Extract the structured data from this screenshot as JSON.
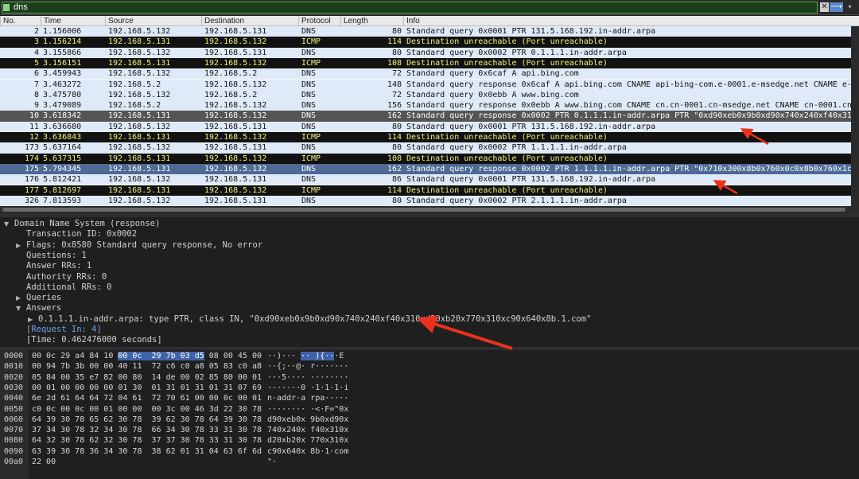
{
  "filter": {
    "value": "dns",
    "clear_icon": "clear-icon",
    "apply_icon": "apply-arrow-icon"
  },
  "columns": [
    "No.",
    "Time",
    "Source",
    "Destination",
    "Protocol",
    "Length",
    "Info"
  ],
  "packets": [
    {
      "no": "2",
      "time": "1.156006",
      "src": "192.168.5.132",
      "dst": "192.168.5.131",
      "proto": "DNS",
      "len": "80",
      "info": "Standard query 0x0001 PTR 131.5.168.192.in-addr.arpa",
      "style": "dns"
    },
    {
      "no": "3",
      "time": "1.156214",
      "src": "192.168.5.131",
      "dst": "192.168.5.132",
      "proto": "ICMP",
      "len": "114",
      "info": "Destination unreachable (Port unreachable)",
      "style": "icmp"
    },
    {
      "no": "4",
      "time": "3.155866",
      "src": "192.168.5.132",
      "dst": "192.168.5.131",
      "proto": "DNS",
      "len": "80",
      "info": "Standard query 0x0002 PTR 0.1.1.1.in-addr.arpa",
      "style": "dns"
    },
    {
      "no": "5",
      "time": "3.156151",
      "src": "192.168.5.131",
      "dst": "192.168.5.132",
      "proto": "ICMP",
      "len": "108",
      "info": "Destination unreachable (Port unreachable)",
      "style": "icmp"
    },
    {
      "no": "6",
      "time": "3.459943",
      "src": "192.168.5.132",
      "dst": "192.168.5.2",
      "proto": "DNS",
      "len": "72",
      "info": "Standard query 0x6caf A api.bing.com",
      "style": "dns"
    },
    {
      "no": "7",
      "time": "3.463272",
      "src": "192.168.5.2",
      "dst": "192.168.5.132",
      "proto": "DNS",
      "len": "148",
      "info": "Standard query response 0x6caf A api.bing.com CNAME api-bing-com.e-0001.e-msedge.net CNAME e-0…",
      "style": "dns"
    },
    {
      "no": "8",
      "time": "3.475780",
      "src": "192.168.5.132",
      "dst": "192.168.5.2",
      "proto": "DNS",
      "len": "72",
      "info": "Standard query 0x0ebb A www.bing.com",
      "style": "dns"
    },
    {
      "no": "9",
      "time": "3.479089",
      "src": "192.168.5.2",
      "dst": "192.168.5.132",
      "proto": "DNS",
      "len": "156",
      "info": "Standard query response 0x0ebb A www.bing.com CNAME cn.cn-0001.cn-msedge.net CNAME cn-0001.cn-…",
      "style": "dns"
    },
    {
      "no": "10",
      "time": "3.618342",
      "src": "192.168.5.131",
      "dst": "192.168.5.132",
      "proto": "DNS",
      "len": "162",
      "info": "Standard query response 0x0002 PTR 0.1.1.1.in-addr.arpa PTR \"0xd90xeb0x9b0xd90x740x240xf40x310…",
      "style": "sel-dark"
    },
    {
      "no": "11",
      "time": "3.636680",
      "src": "192.168.5.132",
      "dst": "192.168.5.131",
      "proto": "DNS",
      "len": "80",
      "info": "Standard query 0x0001 PTR 131.5.168.192.in-addr.arpa",
      "style": "dns"
    },
    {
      "no": "12",
      "time": "3.636843",
      "src": "192.168.5.131",
      "dst": "192.168.5.132",
      "proto": "ICMP",
      "len": "114",
      "info": "Destination unreachable (Port unreachable)",
      "style": "icmp"
    },
    {
      "no": "173",
      "time": "5.637164",
      "src": "192.168.5.132",
      "dst": "192.168.5.131",
      "proto": "DNS",
      "len": "80",
      "info": "Standard query 0x0002 PTR 1.1.1.1.in-addr.arpa",
      "style": "dns"
    },
    {
      "no": "174",
      "time": "5.637315",
      "src": "192.168.5.131",
      "dst": "192.168.5.132",
      "proto": "ICMP",
      "len": "108",
      "info": "Destination unreachable (Port unreachable)",
      "style": "icmp"
    },
    {
      "no": "175",
      "time": "5.794345",
      "src": "192.168.5.131",
      "dst": "192.168.5.132",
      "proto": "DNS",
      "len": "162",
      "info": "Standard query response 0x0002 PTR 1.1.1.1.in-addr.arpa PTR \"0x710x300x8b0x760x0c0x8b0x760x1c0…",
      "style": "sel-blue"
    },
    {
      "no": "176",
      "time": "5.812421",
      "src": "192.168.5.132",
      "dst": "192.168.5.131",
      "proto": "DNS",
      "len": "86",
      "info": "Standard query 0x0001 PTR 131.5.168.192.in-addr.arpa",
      "style": "dns"
    },
    {
      "no": "177",
      "time": "5.812697",
      "src": "192.168.5.131",
      "dst": "192.168.5.132",
      "proto": "ICMP",
      "len": "114",
      "info": "Destination unreachable (Port unreachable)",
      "style": "icmp"
    },
    {
      "no": "326",
      "time": "7.813593",
      "src": "192.168.5.132",
      "dst": "192.168.5.131",
      "proto": "DNS",
      "len": "80",
      "info": "Standard query 0x0002 PTR 2.1.1.1.in-addr.arpa",
      "style": "dns"
    }
  ],
  "details": [
    {
      "text": "Domain Name System (response)",
      "arrow": "▼",
      "level": 0
    },
    {
      "text": "Transaction ID: 0x0002",
      "arrow": "",
      "level": 1
    },
    {
      "text": "Flags: 0x8580 Standard query response, No error",
      "arrow": "▶",
      "level": 1
    },
    {
      "text": "Questions: 1",
      "arrow": "",
      "level": 1
    },
    {
      "text": "Answer RRs: 1",
      "arrow": "",
      "level": 1
    },
    {
      "text": "Authority RRs: 0",
      "arrow": "",
      "level": 1
    },
    {
      "text": "Additional RRs: 0",
      "arrow": "",
      "level": 1
    },
    {
      "text": "Queries",
      "arrow": "▶",
      "level": 1
    },
    {
      "text": "Answers",
      "arrow": "▼",
      "level": 1
    },
    {
      "text": "0.1.1.1.in-addr.arpa: type PTR, class IN, \"0xd90xeb0x9b0xd90x740x240xf40x310xd20xb20x770x310xc90x640x8b.1.com\"",
      "arrow": "▶",
      "level": 2
    },
    {
      "text": "[Request In: 4]",
      "arrow": "",
      "level": 1,
      "link": true
    },
    {
      "text": "[Time: 0.462476000 seconds]",
      "arrow": "",
      "level": 1
    }
  ],
  "bytes": [
    {
      "off": "0000",
      "hex_pre": "00 0c 29 a4 84 10 ",
      "hex_hl": "00 0c  29 7b 03 d5",
      "hex_post": " 08 00 45 00",
      "asc_pre": "··)··· ",
      "asc_hl": "·· ){··",
      "asc_post": "·E"
    },
    {
      "off": "0010",
      "hex_pre": "00 94 7b 3b 00 00 40 11  72 c6 c0 a8 05 83 c0 a8",
      "hex_hl": "",
      "hex_post": "",
      "asc_pre": "··{;··@· r·······",
      "asc_hl": "",
      "asc_post": ""
    },
    {
      "off": "0020",
      "hex_pre": "05 84 00 35 e7 82 00 80  14 de 00 02 85 80 00 01",
      "hex_hl": "",
      "hex_post": "",
      "asc_pre": "···5···· ········",
      "asc_hl": "",
      "asc_post": ""
    },
    {
      "off": "0030",
      "hex_pre": "00 01 00 00 00 00 01 30  01 31 01 31 01 31 07 69",
      "hex_hl": "",
      "hex_post": "",
      "asc_pre": "·······0 ·1·1·1·i",
      "asc_hl": "",
      "asc_post": ""
    },
    {
      "off": "0040",
      "hex_pre": "6e 2d 61 64 64 72 04 61  72 70 61 00 00 0c 00 01",
      "hex_hl": "",
      "hex_post": "",
      "asc_pre": "n-addr·a rpa·····",
      "asc_hl": "",
      "asc_post": ""
    },
    {
      "off": "0050",
      "hex_pre": "c0 0c 00 0c 00 01 00 00  00 3c 00 46 3d 22 30 78",
      "hex_hl": "",
      "hex_post": "",
      "asc_pre": "········ ·<·F=\"0x",
      "asc_hl": "",
      "asc_post": ""
    },
    {
      "off": "0060",
      "hex_pre": "64 39 30 78 65 62 30 78  39 62 30 78 64 39 30 78",
      "hex_hl": "",
      "hex_post": "",
      "asc_pre": "d90xeb0x 9b0xd90x",
      "asc_hl": "",
      "asc_post": ""
    },
    {
      "off": "0070",
      "hex_pre": "37 34 30 78 32 34 30 78  66 34 30 78 33 31 30 78",
      "hex_hl": "",
      "hex_post": "",
      "asc_pre": "740x240x f40x310x",
      "asc_hl": "",
      "asc_post": ""
    },
    {
      "off": "0080",
      "hex_pre": "64 32 30 78 62 32 30 78  37 37 30 78 33 31 30 78",
      "hex_hl": "",
      "hex_post": "",
      "asc_pre": "d20xb20x 770x310x",
      "asc_hl": "",
      "asc_post": ""
    },
    {
      "off": "0090",
      "hex_pre": "63 39 30 78 36 34 30 78  38 62 01 31 04 63 6f 6d",
      "hex_hl": "",
      "hex_post": "",
      "asc_pre": "c90x640x 8b·1·com",
      "asc_hl": "",
      "asc_post": ""
    },
    {
      "off": "00a0",
      "hex_pre": "22 00",
      "hex_hl": "",
      "hex_post": "",
      "asc_pre": "\"·",
      "asc_hl": "",
      "asc_post": ""
    }
  ],
  "annotation_color": "#e8321e"
}
